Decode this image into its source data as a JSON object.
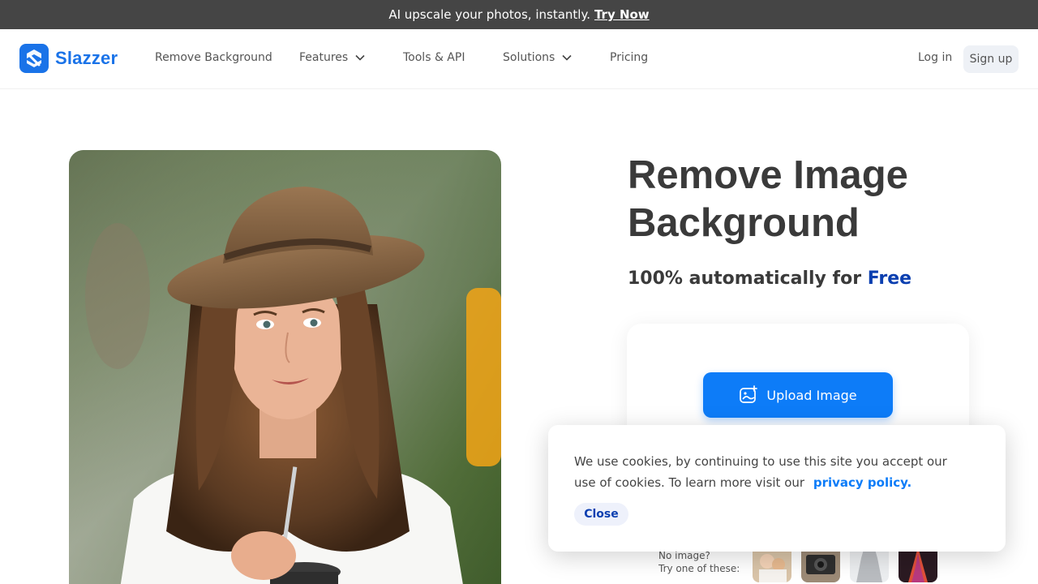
{
  "announcement": {
    "text": "AI upscale your photos, instantly.",
    "cta": "Try Now"
  },
  "header": {
    "logo_text": "Slazzer",
    "nav": [
      {
        "label": "Remove Background",
        "dropdown": false
      },
      {
        "label": "Features",
        "dropdown": true
      },
      {
        "label": "Tools & API",
        "dropdown": false
      },
      {
        "label": "Solutions",
        "dropdown": true
      },
      {
        "label": "Pricing",
        "dropdown": false
      }
    ],
    "login": "Log in",
    "signup": "Sign up"
  },
  "hero": {
    "title": "Remove Image Background",
    "subtitle_prefix": "100% automatically for",
    "subtitle_accent": "Free",
    "upload_label": "Upload Image",
    "samples_line1": "No image?",
    "samples_line2": "Try one of these:"
  },
  "cookie": {
    "text": "We use cookies, by continuing to use this site you accept our use of cookies.  To learn more visit our",
    "link": "privacy policy.",
    "close": "Close"
  },
  "colors": {
    "brand": "#1a73e8",
    "accent": "#0b3fb0",
    "button": "#0d7cf8",
    "announcement_bg": "#454545"
  }
}
